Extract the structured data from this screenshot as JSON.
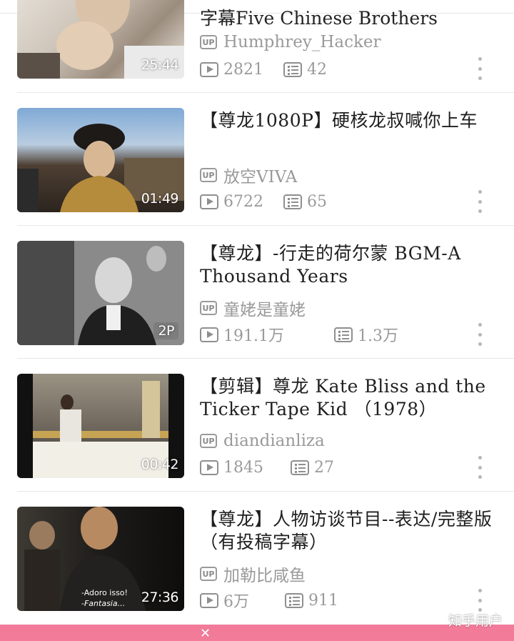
{
  "partial_title": "字幕Five Chinese Brothers",
  "up_label": "UP",
  "videos": [
    {
      "title": "",
      "uploader": "Humphrey_Hacker",
      "duration": "25:44",
      "plays": "2821",
      "comments": "42"
    },
    {
      "title": "【尊龙1080P】硬核龙叔喊你上车",
      "uploader": "放空VIVA",
      "duration": "01:49",
      "plays": "6722",
      "comments": "65"
    },
    {
      "title": "【尊龙】-行走的荷尔蒙 BGM-A Thousand Years",
      "uploader": "童姥是童姥",
      "duration": "2P",
      "plays": "191.1万",
      "comments": "1.3万"
    },
    {
      "title": "【剪辑】尊龙 Kate Bliss and the Ticker Tape Kid （1978）",
      "uploader": "diandianliza",
      "duration": "00:42",
      "plays": "1845",
      "comments": "27"
    },
    {
      "title": "【尊龙】人物访谈节目--表达/完整版（有投稿字幕）",
      "uploader": "加勒比咸鱼",
      "duration": "27:36",
      "plays": "6万",
      "comments": "911"
    }
  ],
  "thumb_subtitles": [
    "-Adoro isso!",
    "-Fantasia..."
  ],
  "watermark": "知乎用户",
  "colors": {
    "accent": "#f27b9a"
  }
}
